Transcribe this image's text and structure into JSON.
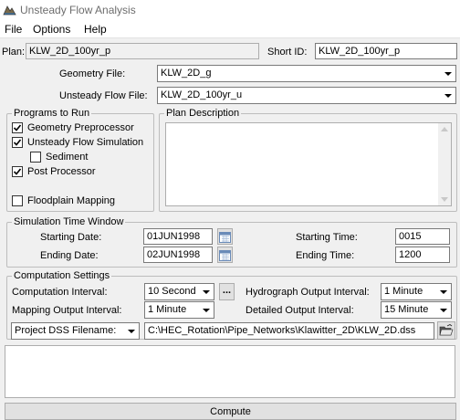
{
  "window": {
    "title": "Unsteady Flow Analysis"
  },
  "menu": [
    {
      "label": "File"
    },
    {
      "label": "Options"
    },
    {
      "label": "Help"
    }
  ],
  "plan": {
    "plan_label": "Plan:",
    "plan_value": "KLW_2D_100yr_p",
    "short_id_label": "Short ID:",
    "short_id_value": "KLW_2D_100yr_p"
  },
  "files": {
    "geometry_label": "Geometry File:",
    "geometry_value": "KLW_2D_g",
    "unsteady_label": "Unsteady Flow File:",
    "unsteady_value": "KLW_2D_100yr_u"
  },
  "programs": {
    "legend": "Programs to Run",
    "items": [
      {
        "label": "Geometry Preprocessor",
        "checked": true
      },
      {
        "label": "Unsteady Flow Simulation",
        "checked": true
      },
      {
        "label": "Sediment",
        "checked": false
      },
      {
        "label": "Post Processor",
        "checked": true
      },
      {
        "label": "Floodplain Mapping",
        "checked": false
      }
    ]
  },
  "plan_description": {
    "legend": "Plan Description",
    "text": ""
  },
  "time_window": {
    "legend": "Simulation Time Window",
    "starting_date_label": "Starting Date:",
    "starting_date": "01JUN1998",
    "ending_date_label": "Ending Date:",
    "ending_date": "02JUN1998",
    "starting_time_label": "Starting Time:",
    "starting_time": "0015",
    "ending_time_label": "Ending Time:",
    "ending_time": "1200"
  },
  "computation": {
    "legend": "Computation Settings",
    "comp_interval_label": "Computation Interval:",
    "comp_interval": "10 Second",
    "ellipsis": "...",
    "hydro_interval_label": "Hydrograph Output Interval:",
    "hydro_interval": "1 Minute",
    "mapping_interval_label": "Mapping Output Interval:",
    "mapping_interval": "1 Minute",
    "detailed_interval_label": "Detailed Output Interval:",
    "detailed_interval": "15 Minute",
    "dss_selector": "Project DSS Filename:",
    "dss_path": "C:\\HEC_Rotation\\Pipe_Networks\\Klawitter_2D\\KLW_2D.dss"
  },
  "messages": {
    "text": ""
  },
  "compute": {
    "label": "Compute"
  },
  "icons": {
    "app": "hec-ras-icon",
    "calendar": "calendar-icon",
    "folder": "open-folder-icon",
    "checkmark": "checkmark-icon",
    "dropdown": "chevron-down-icon"
  },
  "colors": {
    "accent": "#0078d7",
    "disabled_text": "#6d6d6d",
    "panel": "#f0f0f0"
  }
}
